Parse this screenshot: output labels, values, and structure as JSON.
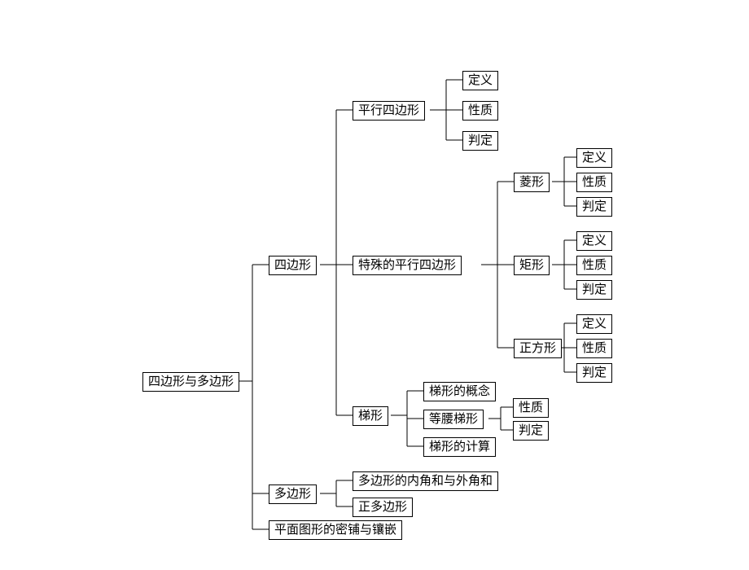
{
  "chart_data": {
    "type": "tree",
    "title": "",
    "root": {
      "label": "四边形与多边形",
      "children": [
        {
          "label": "四边形",
          "children": [
            {
              "label": "平行四边形",
              "children": [
                {
                  "label": "定义"
                },
                {
                  "label": "性质"
                },
                {
                  "label": "判定"
                }
              ]
            },
            {
              "label": "特殊的平行四边形",
              "children": [
                {
                  "label": "菱形",
                  "children": [
                    {
                      "label": "定义"
                    },
                    {
                      "label": "性质"
                    },
                    {
                      "label": "判定"
                    }
                  ]
                },
                {
                  "label": "矩形",
                  "children": [
                    {
                      "label": "定义"
                    },
                    {
                      "label": "性质"
                    },
                    {
                      "label": "判定"
                    }
                  ]
                },
                {
                  "label": "正方形",
                  "children": [
                    {
                      "label": "定义"
                    },
                    {
                      "label": "性质"
                    },
                    {
                      "label": "判定"
                    }
                  ]
                }
              ]
            },
            {
              "label": "梯形",
              "children": [
                {
                  "label": "梯形的概念"
                },
                {
                  "label": "等腰梯形",
                  "children": [
                    {
                      "label": "性质"
                    },
                    {
                      "label": "判定"
                    }
                  ]
                },
                {
                  "label": "梯形的计算"
                }
              ]
            }
          ]
        },
        {
          "label": "多边形",
          "children": [
            {
              "label": "多边形的内角和与外角和"
            },
            {
              "label": "正多边形"
            }
          ]
        },
        {
          "label": "平面图形的密铺与镶嵌"
        }
      ]
    }
  }
}
